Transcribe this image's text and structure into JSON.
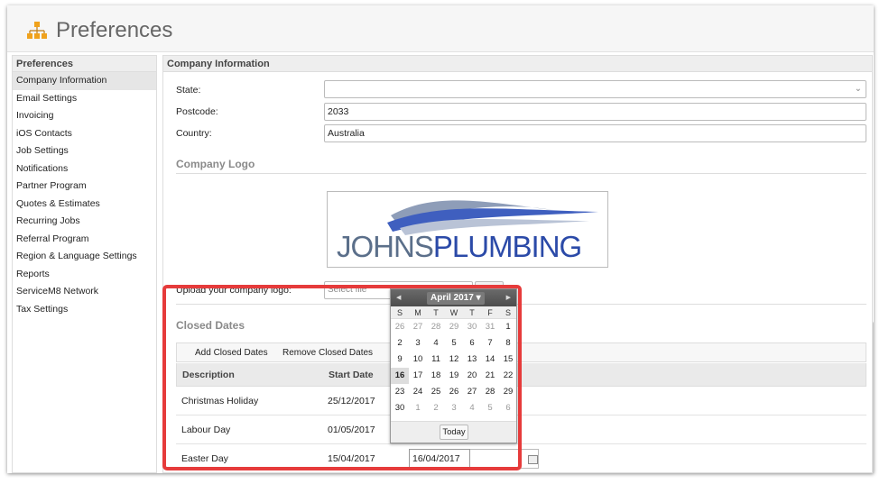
{
  "header": {
    "title": "Preferences",
    "icon": "org-chart-icon"
  },
  "sidebar": {
    "heading": "Preferences",
    "items": [
      {
        "label": "Company Information"
      },
      {
        "label": "Email Settings"
      },
      {
        "label": "Invoicing"
      },
      {
        "label": "iOS Contacts"
      },
      {
        "label": "Job Settings"
      },
      {
        "label": "Notifications"
      },
      {
        "label": "Partner Program"
      },
      {
        "label": "Quotes & Estimates"
      },
      {
        "label": "Recurring Jobs"
      },
      {
        "label": "Referral Program"
      },
      {
        "label": "Region & Language Settings"
      },
      {
        "label": "Reports"
      },
      {
        "label": "ServiceM8 Network"
      },
      {
        "label": "Tax Settings"
      }
    ]
  },
  "main": {
    "heading": "Company Information",
    "fields": {
      "state": {
        "label": "State:",
        "value": ""
      },
      "postcode": {
        "label": "Postcode:",
        "value": "2033"
      },
      "country": {
        "label": "Country:",
        "value": "Australia"
      }
    },
    "logo_section": {
      "title": "Company Logo",
      "logo_text_a": "JOHNS",
      "logo_text_b": "PLUMBING",
      "upload_label": "Upload your company logo:",
      "upload_placeholder": "Select file"
    },
    "closed_dates": {
      "title": "Closed Dates",
      "add_label": "Add Closed Dates",
      "remove_label": "Remove Closed Dates",
      "columns": [
        "Description",
        "Start Date"
      ],
      "rows": [
        {
          "description": "Christmas Holiday",
          "start": "25/12/2017"
        },
        {
          "description": "Labour Day",
          "start": "01/05/2017"
        },
        {
          "description": "Easter Day",
          "start": "15/04/2017"
        }
      ],
      "editing_value": "16/04/2017"
    }
  },
  "calendar": {
    "month_label": "April 2017",
    "dow": [
      "S",
      "M",
      "T",
      "W",
      "T",
      "F",
      "S"
    ],
    "weeks": [
      [
        "26",
        "27",
        "28",
        "29",
        "30",
        "31",
        "1"
      ],
      [
        "2",
        "3",
        "4",
        "5",
        "6",
        "7",
        "8"
      ],
      [
        "9",
        "10",
        "11",
        "12",
        "13",
        "14",
        "15"
      ],
      [
        "16",
        "17",
        "18",
        "19",
        "20",
        "21",
        "22"
      ],
      [
        "23",
        "24",
        "25",
        "26",
        "27",
        "28",
        "29"
      ],
      [
        "30",
        "1",
        "2",
        "3",
        "4",
        "5",
        "6"
      ]
    ],
    "selected_day": "16",
    "today_label": "Today"
  },
  "colors": {
    "highlight": "#e63b3b",
    "logo_blue": "#2b4aa8",
    "logo_grey": "#5b6f8a"
  }
}
